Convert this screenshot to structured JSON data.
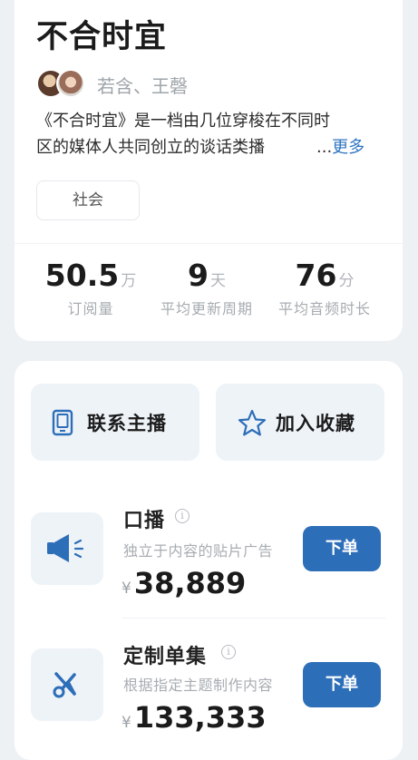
{
  "podcast": {
    "title": "不合时宜",
    "hosts": "若含、王磬",
    "description_line1": "《不合时宜》是一档由几位穿梭在不同时",
    "description_line2": "区的媒体人共同创立的谈话类播",
    "ellipsis": "...",
    "more_label": "更多",
    "tag": "社会"
  },
  "stats": [
    {
      "value": "50.5",
      "unit": "万",
      "label": "订阅量"
    },
    {
      "value": "9",
      "unit": "天",
      "label": "平均更新周期"
    },
    {
      "value": "76",
      "unit": "分",
      "label": "平均音频时长"
    }
  ],
  "actions": {
    "contact_label": "联系主播",
    "favorite_label": "加入收藏"
  },
  "services": [
    {
      "title": "口播",
      "subtitle": "独立于内容的贴片广告",
      "currency": "¥",
      "price": "38,889",
      "button": "下单",
      "icon": "megaphone-icon"
    },
    {
      "title": "定制单集",
      "subtitle": "根据指定主题制作内容",
      "currency": "¥",
      "price": "133,333",
      "button": "下单",
      "icon": "scissors-icon"
    }
  ],
  "colors": {
    "accent": "#2d6eb8",
    "link": "#2f74c0",
    "background": "#eef1f4"
  }
}
